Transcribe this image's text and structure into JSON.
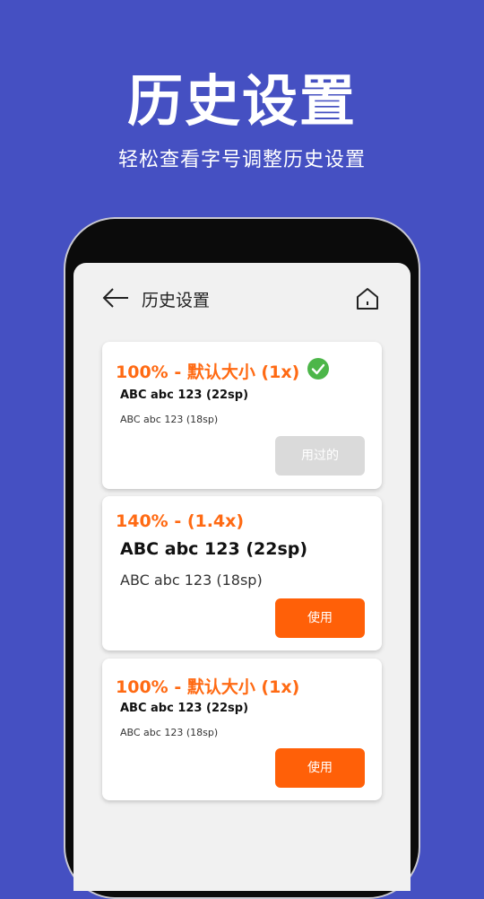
{
  "hero": {
    "title": "历史设置",
    "subtitle": "轻松查看字号调整历史设置"
  },
  "topbar": {
    "title": "历史设置",
    "back_icon": "arrow-left-icon",
    "home_icon": "home-icon"
  },
  "colors": {
    "background": "#4550C2",
    "accent": "#FF6A13",
    "button_active": "#FF6008",
    "button_disabled": "#DADADA",
    "check": "#4CB649"
  },
  "cards": [
    {
      "heading": "100% - 默认大小 (1x)",
      "selected": true,
      "sample_large": "ABC abc 123 (22sp)",
      "sample_small": "ABC abc 123 (18sp)",
      "button_label": "用过的",
      "button_enabled": false
    },
    {
      "heading": "140% - (1.4x)",
      "selected": false,
      "sample_large": "ABC abc 123 (22sp)",
      "sample_small": "ABC abc 123 (18sp)",
      "button_label": "使用",
      "button_enabled": true
    },
    {
      "heading": "100% - 默认大小 (1x)",
      "selected": false,
      "sample_large": "ABC abc 123 (22sp)",
      "sample_small": "ABC abc 123 (18sp)",
      "button_label": "使用",
      "button_enabled": true
    }
  ]
}
